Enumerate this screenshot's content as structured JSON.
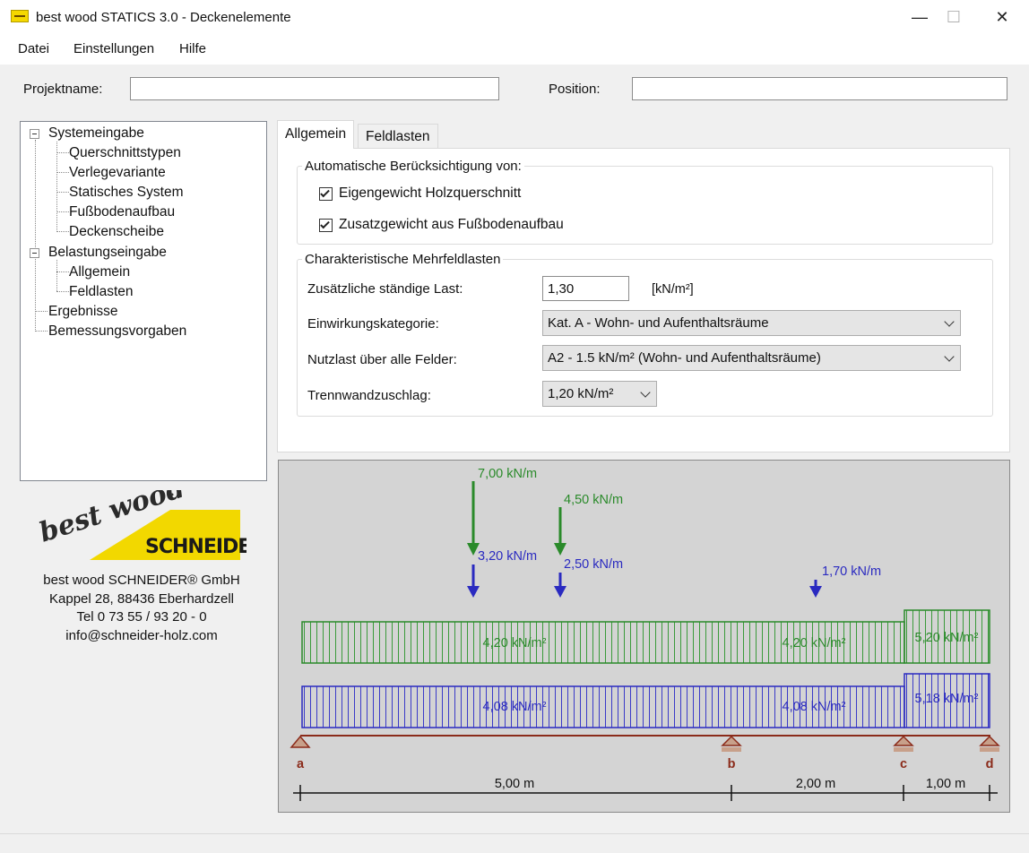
{
  "window": {
    "title": "best wood STATICS 3.0 - Deckenelemente",
    "minimize_glyph": "—",
    "maximize_glyph": "☐",
    "close_glyph": "✕"
  },
  "menu": {
    "items": [
      "Datei",
      "Einstellungen",
      "Hilfe"
    ]
  },
  "project": {
    "name_label": "Projektname:",
    "name_value": "",
    "position_label": "Position:",
    "position_value": ""
  },
  "tree": {
    "items": [
      "Systemeingabe",
      "Querschnittstypen",
      "Verlegevariante",
      "Statisches System",
      "Fußbodenaufbau",
      "Deckenscheibe",
      "Belastungseingabe",
      "Allgemein",
      "Feldlasten",
      "Ergebnisse",
      "Bemessungsvorgaben"
    ]
  },
  "company": {
    "logo_text_top": "best wood",
    "logo_text_bottom": "SCHNEIDER",
    "lines": [
      "best wood SCHNEIDER® GmbH",
      "Kappel 28, 88436 Eberhardzell",
      "Tel 0 73 55 / 93 20 - 0",
      "info@schneider-holz.com"
    ]
  },
  "tabs": [
    "Allgemein",
    "Feldlasten"
  ],
  "auto_group": {
    "title": "Automatische Berücksichtigung von:",
    "checkbox1_label": "Eigengewicht Holzquerschnitt",
    "checkbox1_checked": true,
    "checkbox2_label": "Zusatzgewicht aus Fußbodenaufbau",
    "checkbox2_checked": true
  },
  "loads_group": {
    "title": "Charakteristische Mehrfeldlasten",
    "extra_load_label": "Zusätzliche ständige Last:",
    "extra_load_value": "1,30",
    "extra_load_unit": "[kN/m²]",
    "category_label": "Einwirkungskategorie:",
    "category_value": "Kat. A - Wohn- und Aufenthaltsräume",
    "live_load_label": "Nutzlast über alle Felder:",
    "live_load_value": "A2 - 1.5 kN/m² (Wohn- und Aufenthaltsräume)",
    "partition_label": "Trennwandzuschlag:",
    "partition_value": "1,20 kN/m²"
  },
  "diagram": {
    "colors": {
      "green": "#2a8a2a",
      "blue": "#2a2ac0",
      "beam": "#8b2b1a",
      "support": "#c8a08a",
      "background": "#d4d4d4"
    },
    "point_loads": [
      {
        "green_label": "7,00 kN/m",
        "blue_label": "3,20 kN/m"
      },
      {
        "green_label": "4,50 kN/m",
        "blue_label": "2,50 kN/m"
      },
      {
        "blue_label": "1,70 kN/m"
      }
    ],
    "green_band_labels": [
      "4,20 kN/m²",
      "4,20 kN/m²",
      "5,20 kN/m²"
    ],
    "blue_band_labels": [
      "4,08 kN/m²",
      "4,08 kN/m²",
      "5,18 kN/m²"
    ],
    "supports": [
      "a",
      "b",
      "c",
      "d"
    ],
    "spans": [
      "5,00 m",
      "2,00 m",
      "1,00 m"
    ]
  }
}
